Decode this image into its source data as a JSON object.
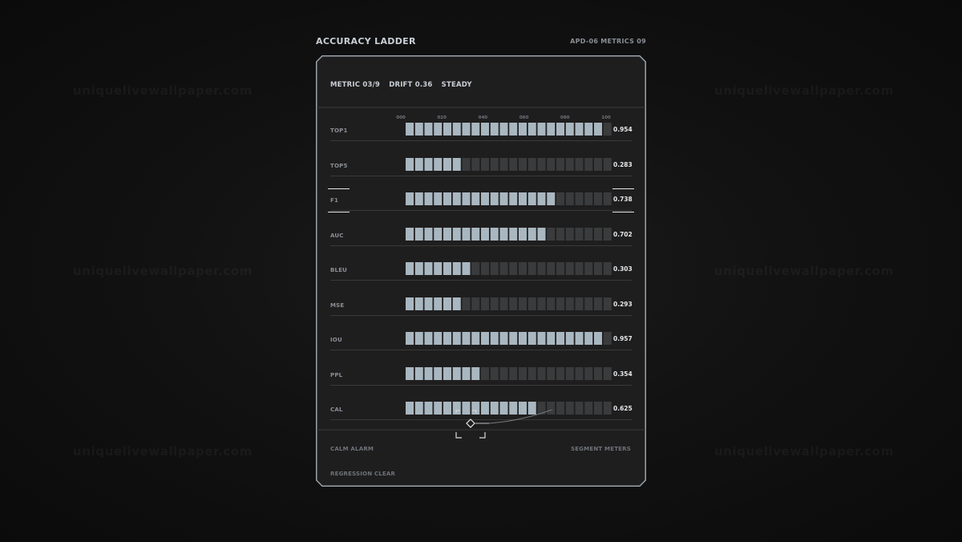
{
  "header": {
    "title": "ACCURACY LADDER",
    "id_label": "APD-06  METRICS 09"
  },
  "status": {
    "metric": "METRIC 03/9",
    "drift": "DRIFT 0.36",
    "state": "STEADY"
  },
  "scale_ticks": [
    "000",
    "020",
    "040",
    "060",
    "080",
    "100"
  ],
  "segments_per_meter": 22,
  "selected_metric": "F1",
  "metrics": [
    {
      "label": "TOP1",
      "value": 0.954,
      "value_text": "0.954"
    },
    {
      "label": "TOP5",
      "value": 0.283,
      "value_text": "0.283"
    },
    {
      "label": "F1",
      "value": 0.738,
      "value_text": "0.738"
    },
    {
      "label": "AUC",
      "value": 0.702,
      "value_text": "0.702"
    },
    {
      "label": "BLEU",
      "value": 0.303,
      "value_text": "0.303"
    },
    {
      "label": "MSE",
      "value": 0.293,
      "value_text": "0.293"
    },
    {
      "label": "IOU",
      "value": 0.957,
      "value_text": "0.957"
    },
    {
      "label": "PPL",
      "value": 0.354,
      "value_text": "0.354"
    },
    {
      "label": "CAL",
      "value": 0.625,
      "value_text": "0.625"
    }
  ],
  "footer": {
    "alarm": "CALM ALARM",
    "mode": "SEGMENT METERS",
    "regression": "REGRESSION CLEAR"
  },
  "watermark": "uniquelivewallpaper.com",
  "colors": {
    "segment_on": "#a9b7c1",
    "segment_off": "#3a3b3c",
    "panel_bg": "#1f1e1e",
    "panel_border": "#9aa3ab"
  }
}
